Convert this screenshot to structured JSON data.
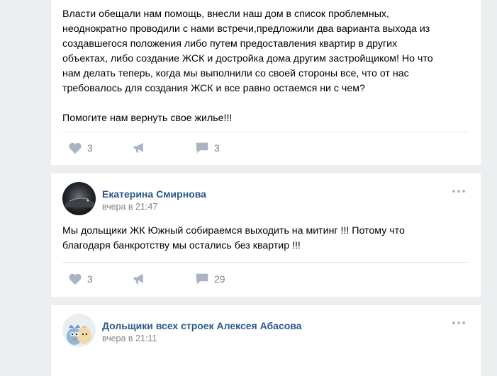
{
  "posts": [
    {
      "text": "Власти обещали нам помощь, внесли наш дом в список проблемных,\nнеоднократно проводили с нами встречи,предложили два варианта выхода из\nсоздавшегося положения либо путем предоставления квартир в других\nобъектах, либо создание ЖСК и достройка дома другим застройщиком! Но что\nнам делать теперь, когда мы выполнили со своей стороны все, что от нас\nтребовалось для создания ЖСК и все равно остаемся ни с чем?\n\nПомогите нам вернуть свое жилье!!!",
      "likes": "3",
      "comments": "3"
    },
    {
      "author": "Екатерина Смирнова",
      "date": "вчера в 21:47",
      "text": "Мы дольщики ЖК Южный собираемся выходить на митинг !!! Потому что\nблагодаря банкротству мы остались без квартир !!!",
      "likes": "3",
      "comments": "29"
    },
    {
      "author": "Дольщики всех строек Алексея Абасова",
      "date": "вчера в 21:11"
    }
  ],
  "icons": {
    "like": "heart-icon",
    "share": "megaphone-icon",
    "comment": "speech-bubble-icon",
    "more": "more-dots-icon"
  },
  "colors": {
    "background": "#edeef0",
    "card": "#ffffff",
    "author_link": "#2a5885",
    "meta_text": "#828282",
    "icon": "#a9b4c2"
  }
}
